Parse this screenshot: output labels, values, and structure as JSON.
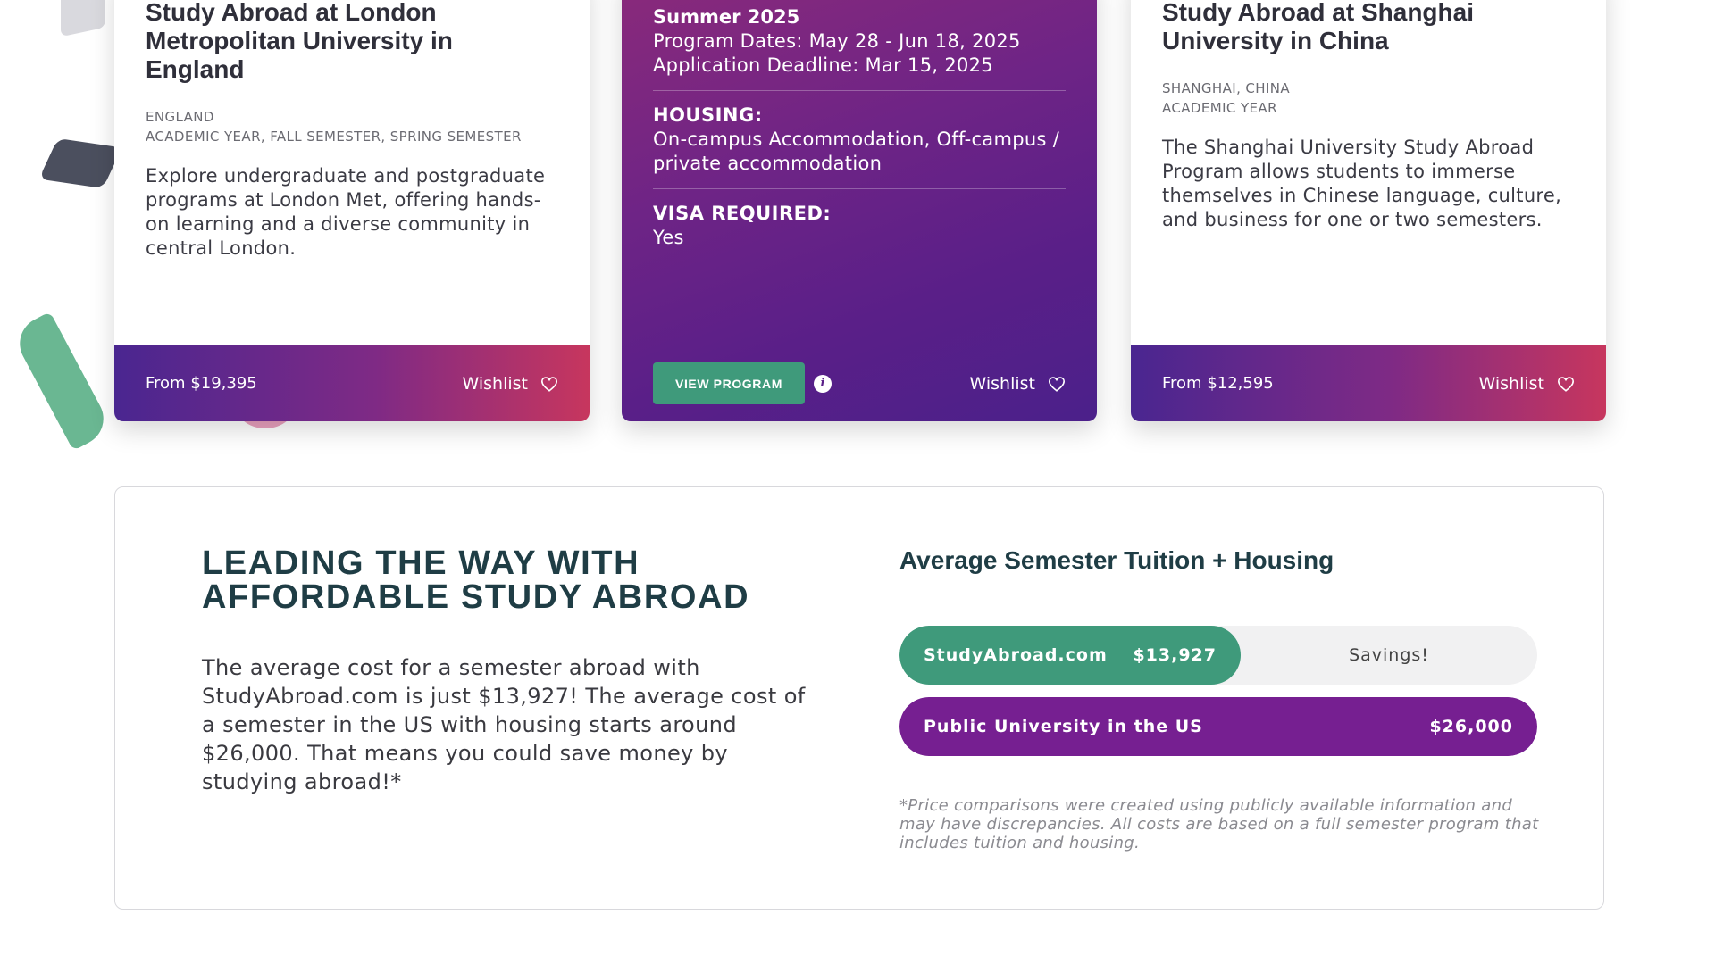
{
  "cards": [
    {
      "title": "Study Abroad at London Metropolitan University in England",
      "location": "ENGLAND",
      "terms": "ACADEMIC YEAR, FALL SEMESTER, SPRING SEMESTER",
      "description": "Explore undergraduate and postgraduate programs at London Met, offering hands-on learning and a diverse community in central London.",
      "price": "From $19,395",
      "wishlist_label": "Wishlist"
    },
    {
      "season": "Summer 2025",
      "program_dates": "Program Dates: May 28 - Jun 18, 2025",
      "application_deadline": "Application Deadline: Mar 15, 2025",
      "housing_label": "HOUSING:",
      "housing_value": "On-campus Accommodation, Off-campus / private accommodation",
      "visa_label": "VISA REQUIRED:",
      "visa_value": "Yes",
      "view_button": "VIEW PROGRAM",
      "info_glyph": "i",
      "wishlist_label": "Wishlist"
    },
    {
      "title": "Study Abroad at Shanghai University in China",
      "location": "SHANGHAI, CHINA",
      "terms": "ACADEMIC YEAR",
      "description": "The Shanghai University Study Abroad Program allows students to immerse themselves in Chinese language, culture, and business for one or two semesters.",
      "price": "From $12,595",
      "wishlist_label": "Wishlist"
    }
  ],
  "affordability": {
    "heading": "LEADING THE WAY WITH AFFORDABLE STUDY ABROAD",
    "body": "The average cost for a semester abroad with StudyAbroad.com is just $13,927! The average cost of a semester in the US with housing starts around $26,000. That means you could save money by studying abroad!*",
    "chart_title": "Average Semester Tuition + Housing",
    "bars": [
      {
        "label": "StudyAbroad.com",
        "value_text": "$13,927",
        "value": 13927,
        "color": "#3f9a7b",
        "remainder_label": "Savings!"
      },
      {
        "label": "Public University in the US",
        "value_text": "$26,000",
        "value": 26000,
        "color": "#761f91"
      }
    ],
    "disclaimer": "*Price comparisons were created using publicly available information and may have discrepancies. All costs are based on a full semester program that includes tuition and housing."
  },
  "icons": {
    "heart": "heart-icon",
    "info": "info-icon"
  }
}
